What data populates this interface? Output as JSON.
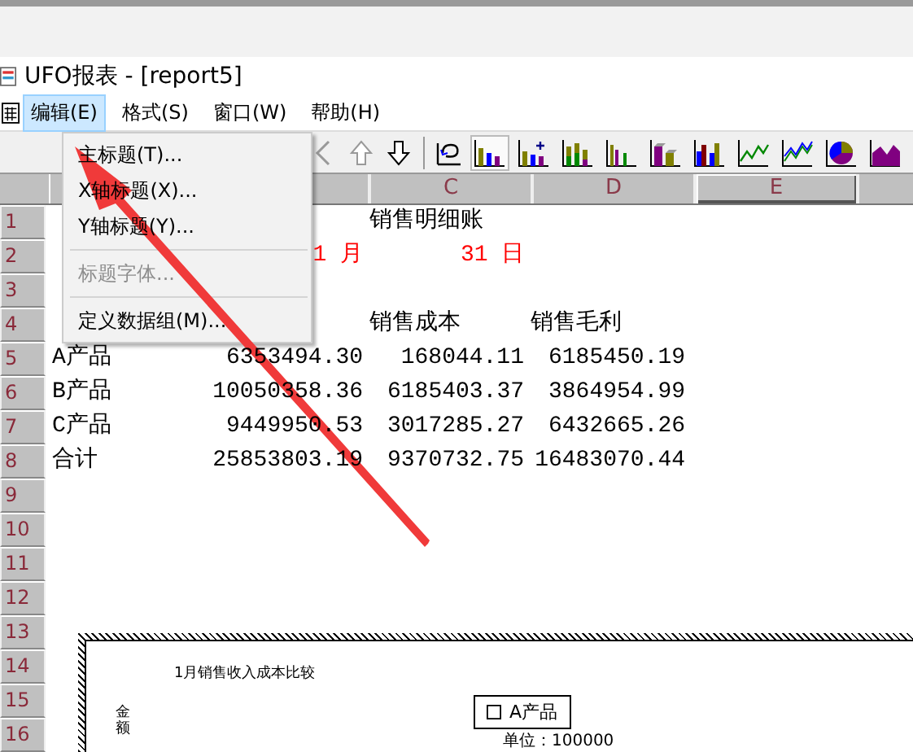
{
  "window": {
    "title": "UFO报表 - [report5]"
  },
  "menu_bar": [
    {
      "label": "编辑(E)",
      "selected": true
    },
    {
      "label": "格式(S)",
      "selected": false
    },
    {
      "label": "窗口(W)",
      "selected": false
    },
    {
      "label": "帮助(H)",
      "selected": false
    }
  ],
  "dropdown_menu": [
    {
      "kind": "item",
      "label": "主标题(T)...",
      "disabled": false
    },
    {
      "kind": "item",
      "label": "X轴标题(X)...",
      "disabled": false
    },
    {
      "kind": "item",
      "label": "Y轴标题(Y)...",
      "disabled": false
    },
    {
      "kind": "separator"
    },
    {
      "kind": "item",
      "label": "标题字体...",
      "disabled": true
    },
    {
      "kind": "separator"
    },
    {
      "kind": "item",
      "label": "定义数据组(M)...",
      "disabled": false
    }
  ],
  "toolbar": {
    "nav_buttons": [
      {
        "kind": "left"
      },
      {
        "kind": "up"
      },
      {
        "kind": "down"
      },
      {
        "kind": "undo"
      }
    ],
    "chart_types": [
      {
        "kind": "bar",
        "selected": true
      },
      {
        "kind": "plusbar",
        "selected": false
      },
      {
        "kind": "stacked",
        "selected": false
      },
      {
        "kind": "thinbar",
        "selected": false
      },
      {
        "kind": "solid",
        "selected": false
      },
      {
        "kind": "mixed",
        "selected": false
      },
      {
        "kind": "line",
        "selected": false
      },
      {
        "kind": "multiline",
        "selected": false
      },
      {
        "kind": "pie",
        "selected": false
      },
      {
        "kind": "area",
        "selected": false
      }
    ]
  },
  "column_headers": [
    {
      "label": "C",
      "selected": false
    },
    {
      "label": "D",
      "selected": false
    },
    {
      "label": "E",
      "selected": true
    }
  ],
  "row_headers": [
    "1",
    "2",
    "3",
    "4",
    "5",
    "6",
    "7",
    "8",
    "9",
    "10",
    "11",
    "12",
    "13",
    "14",
    "15",
    "16"
  ],
  "sheet": {
    "title": "销售明细账",
    "month": "1 月",
    "day": "31 日",
    "headings": [
      "销售成本",
      "销售毛利"
    ],
    "rows": [
      {
        "name": "A产品",
        "values": [
          "6353494.30",
          "168044.11",
          "6185450.19"
        ]
      },
      {
        "name": "B产品",
        "values": [
          "10050358.36",
          "6185403.37",
          "3864954.99"
        ]
      },
      {
        "name": "C产品",
        "values": [
          "9449950.53",
          "3017285.27",
          "6432665.26"
        ]
      },
      {
        "name": "合计",
        "values": [
          "25853803.19",
          "9370732.75",
          "16483070.44"
        ]
      }
    ]
  },
  "chart_object": {
    "title": "1月销售收入成本比较",
    "ylabel": "金额",
    "legend": [
      "A产品"
    ],
    "unit": "单位：100000"
  }
}
